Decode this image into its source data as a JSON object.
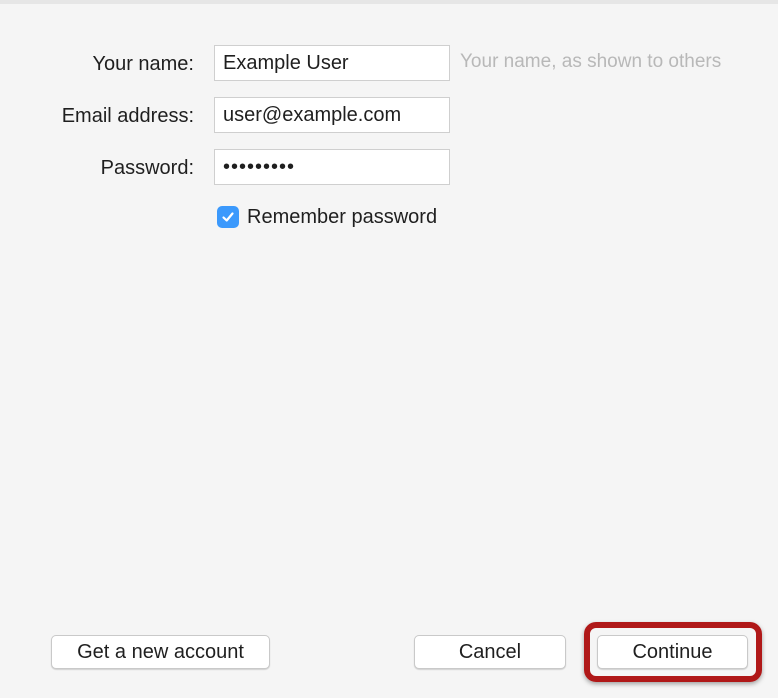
{
  "form": {
    "name": {
      "label": "Your name:",
      "value": "Example User",
      "hint": "Your name, as shown to others"
    },
    "email": {
      "label": "Email address:",
      "value": "user@example.com"
    },
    "password": {
      "label": "Password:",
      "value": "•••••••••"
    },
    "remember": {
      "label": "Remember password",
      "checked": true
    }
  },
  "buttons": {
    "new_account": "Get a new account",
    "cancel": "Cancel",
    "continue": "Continue"
  },
  "colors": {
    "checkbox_accent": "#3b99fc",
    "highlight": "#b01818",
    "hint_text": "#b8b8b8"
  },
  "icons": {
    "checkbox": "checkmark-icon"
  }
}
